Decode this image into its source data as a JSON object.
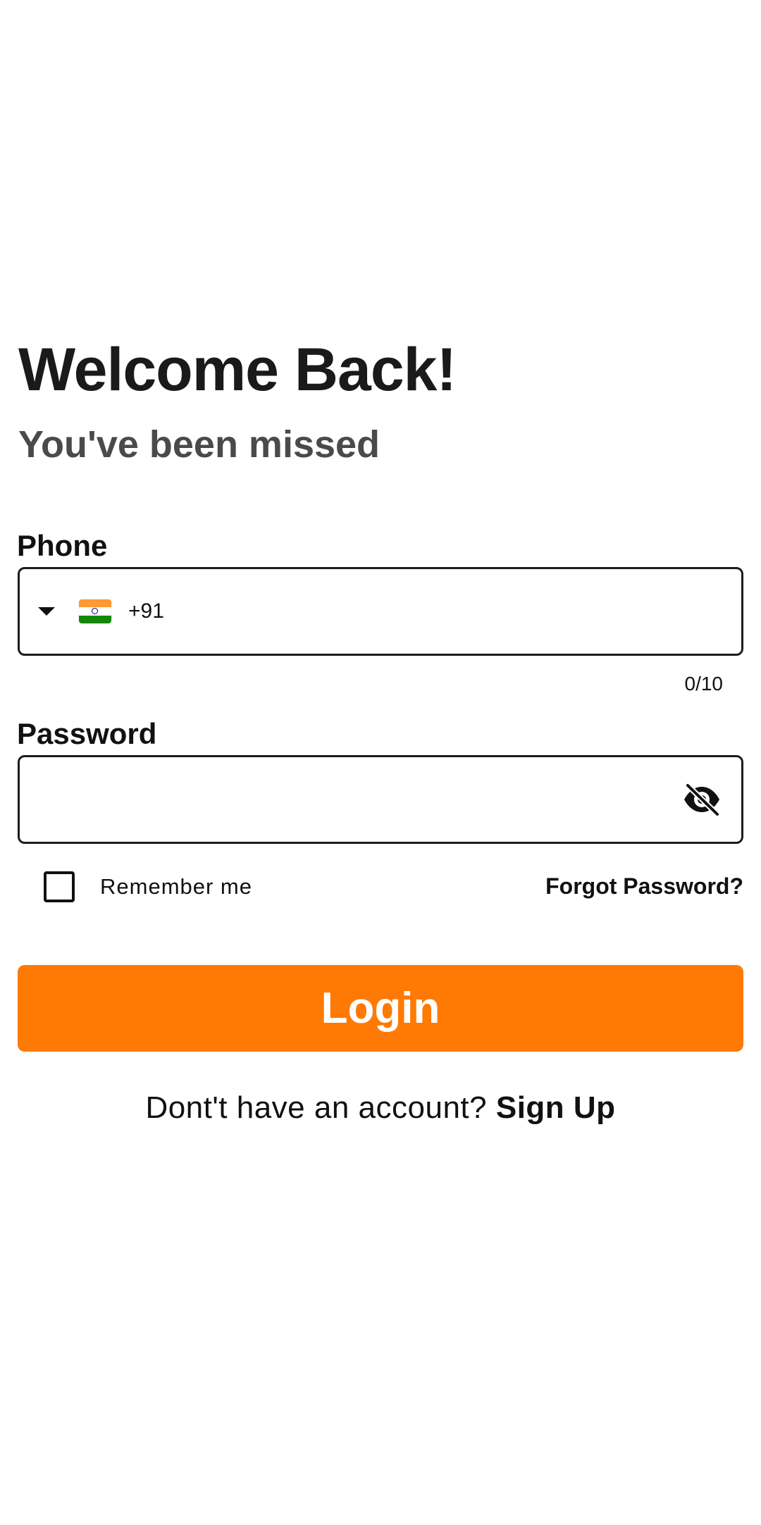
{
  "header": {
    "title": "Welcome Back!",
    "subtitle": "You've been missed"
  },
  "phone": {
    "label": "Phone",
    "country_code": "+91",
    "flag_icon": "india-flag-icon",
    "dropdown_icon": "caret-down-icon",
    "value": "",
    "counter": "0/10"
  },
  "password": {
    "label": "Password",
    "value": "",
    "toggle_icon": "eye-off-icon"
  },
  "remember": {
    "label": "Remember me",
    "checked": false
  },
  "forgot": {
    "label": "Forgot Password?"
  },
  "login": {
    "label": "Login"
  },
  "signup": {
    "prompt": "Dont't have an account?",
    "link": "Sign Up"
  },
  "colors": {
    "accent": "#FF7A05",
    "title": "#1a1a1a",
    "subtitle": "#4a4a4a",
    "background": "#ffffff"
  }
}
